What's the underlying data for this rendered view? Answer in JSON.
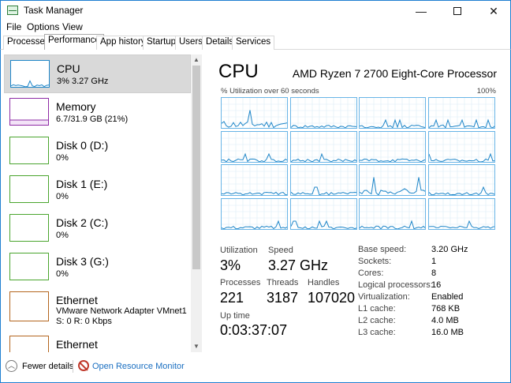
{
  "window": {
    "title": "Task Manager",
    "minimize": "—",
    "close": "✕"
  },
  "menu": [
    "File",
    "Options",
    "View"
  ],
  "tabs": [
    "Processes",
    "Performance",
    "App history",
    "Startup",
    "Users",
    "Details",
    "Services"
  ],
  "sidebar": [
    {
      "title": "CPU",
      "sub": "3% 3.27 GHz",
      "color": "#1f86c8"
    },
    {
      "title": "Memory",
      "sub": "6.7/31.9 GB (21%)",
      "color": "#8e2ba5"
    },
    {
      "title": "Disk 0 (D:)",
      "sub": "0%",
      "color": "#4aa52e"
    },
    {
      "title": "Disk 1 (E:)",
      "sub": "0%",
      "color": "#4aa52e"
    },
    {
      "title": "Disk 2 (C:)",
      "sub": "0%",
      "color": "#4aa52e"
    },
    {
      "title": "Disk 3 (G:)",
      "sub": "0%",
      "color": "#4aa52e"
    },
    {
      "title": "Ethernet",
      "sub": "VMware Network Adapter VMnet1",
      "sub2": "S: 0 R: 0 Kbps",
      "color": "#b4651e"
    },
    {
      "title": "Ethernet",
      "sub": "",
      "color": "#b4651e"
    }
  ],
  "main": {
    "title": "CPU",
    "processor": "AMD Ryzen 7 2700 Eight-Core Processor",
    "graph_label": "% Utilization over 60 seconds",
    "graph_max": "100%",
    "graph_color": "#1f86c8"
  },
  "stats": {
    "utilization_label": "Utilization",
    "utilization": "3%",
    "speed_label": "Speed",
    "speed": "3.27 GHz",
    "processes_label": "Processes",
    "processes": "221",
    "threads_label": "Threads",
    "threads": "3187",
    "handles_label": "Handles",
    "handles": "107020",
    "uptime_label": "Up time",
    "uptime": "0:03:37:07"
  },
  "details": [
    {
      "key": "Base speed:",
      "value": "3.20 GHz"
    },
    {
      "key": "Sockets:",
      "value": "1"
    },
    {
      "key": "Cores:",
      "value": "8"
    },
    {
      "key": "Logical processors:",
      "value": "16"
    },
    {
      "key": "Virtualization:",
      "value": "Enabled"
    },
    {
      "key": "L1 cache:",
      "value": "768 KB"
    },
    {
      "key": "L2 cache:",
      "value": "4.0 MB"
    },
    {
      "key": "L3 cache:",
      "value": "16.0 MB"
    }
  ],
  "footer": {
    "fewer_details": "Fewer details",
    "open_resource_monitor": "Open Resource Monitor"
  }
}
